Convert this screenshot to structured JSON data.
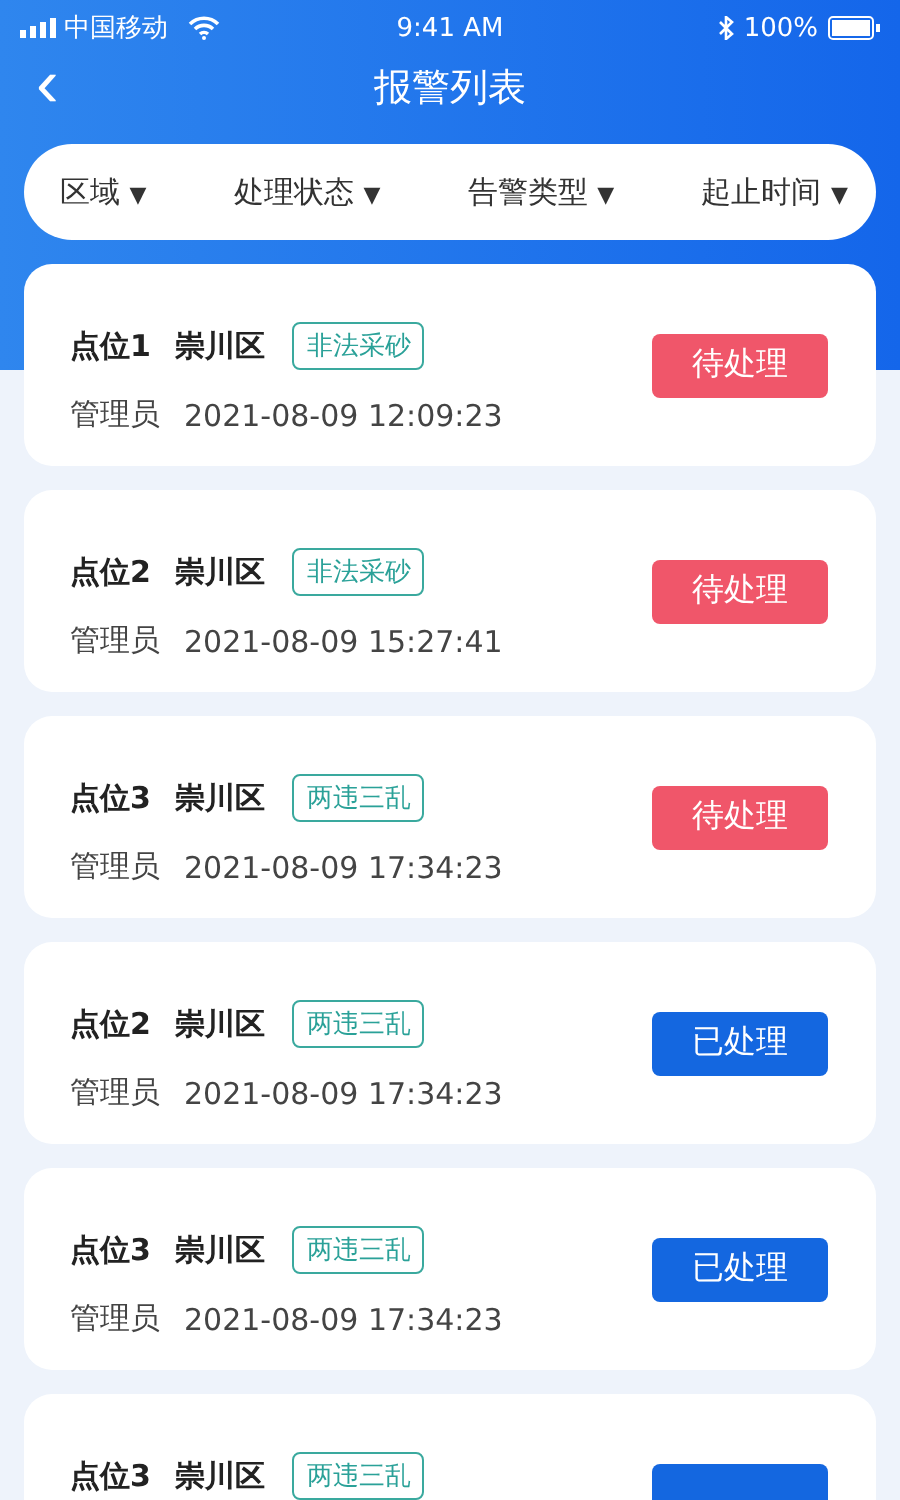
{
  "status_bar": {
    "carrier": "中国移动",
    "time": "9:41 AM",
    "battery": "100%"
  },
  "header": {
    "back": "‹",
    "title": "报警列表"
  },
  "filters": [
    {
      "label": "区域",
      "arrow": "▼"
    },
    {
      "label": "处理状态",
      "arrow": "▼"
    },
    {
      "label": "告警类型",
      "arrow": "▼"
    },
    {
      "label": "起止时间",
      "arrow": "▼"
    }
  ],
  "alarms": [
    {
      "point": "点位1",
      "district": "崇川区",
      "type": "非法采砂",
      "role": "管理员",
      "time": "2021-08-09 12:09:23",
      "status": "待处理",
      "kind": "pending"
    },
    {
      "point": "点位2",
      "district": "崇川区",
      "type": "非法采砂",
      "role": "管理员",
      "time": "2021-08-09 15:27:41",
      "status": "待处理",
      "kind": "pending"
    },
    {
      "point": "点位3",
      "district": "崇川区",
      "type": "两违三乱",
      "role": "管理员",
      "time": "2021-08-09 17:34:23",
      "status": "待处理",
      "kind": "pending"
    },
    {
      "point": "点位2",
      "district": "崇川区",
      "type": "两违三乱",
      "role": "管理员",
      "time": "2021-08-09 17:34:23",
      "status": "已处理",
      "kind": "done"
    },
    {
      "point": "点位3",
      "district": "崇川区",
      "type": "两违三乱",
      "role": "管理员",
      "time": "2021-08-09 17:34:23",
      "status": "已处理",
      "kind": "done"
    },
    {
      "point": "点位3",
      "district": "崇川区",
      "type": "两违三乱",
      "kind": "done"
    }
  ]
}
